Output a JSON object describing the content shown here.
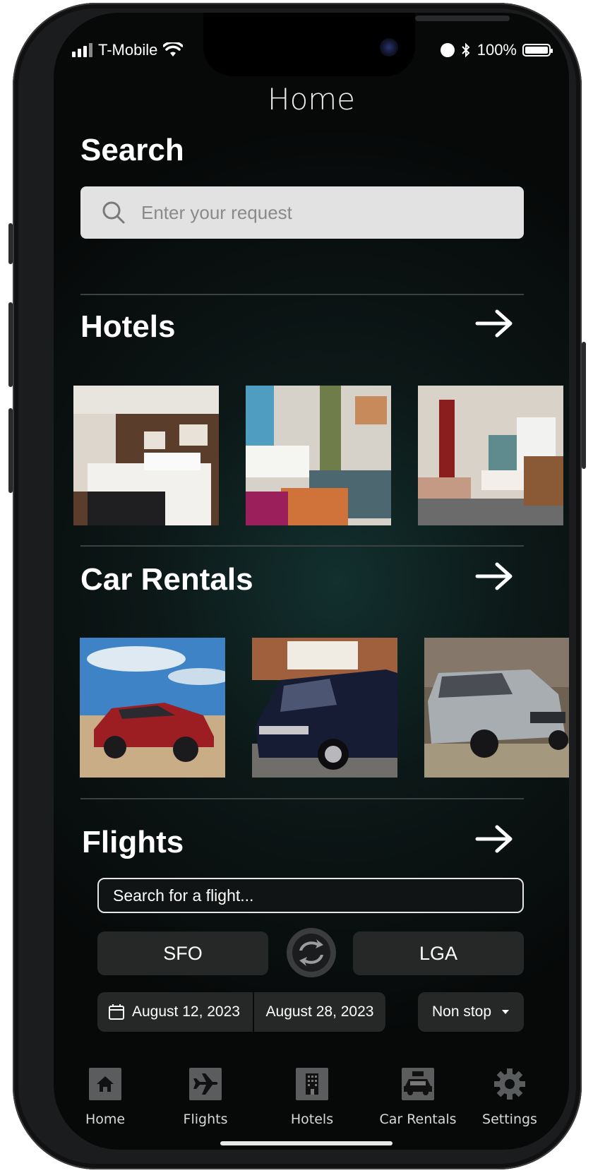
{
  "status": {
    "carrier": "T-Mobile",
    "battery": "100%"
  },
  "page": {
    "title": "Home"
  },
  "search": {
    "heading": "Search",
    "placeholder": "Enter your request"
  },
  "sections": {
    "hotels": {
      "title": "Hotels"
    },
    "car_rentals": {
      "title": "Car Rentals"
    },
    "flights": {
      "title": "Flights",
      "search_placeholder": "Search for a flight...",
      "from": "SFO",
      "to": "LGA",
      "depart_date": "August 12, 2023",
      "return_date": "August 28, 2023",
      "stops": "Non stop"
    }
  },
  "tabbar": {
    "items": [
      {
        "label": "Home",
        "icon": "home-icon"
      },
      {
        "label": "Flights",
        "icon": "airplane-icon"
      },
      {
        "label": "Hotels",
        "icon": "building-icon"
      },
      {
        "label": "Car Rentals",
        "icon": "car-rental-icon"
      },
      {
        "label": "Settings",
        "icon": "gear-icon"
      }
    ]
  },
  "colors": {
    "background": "#0b1514",
    "accent_teal": "#12302e",
    "search_box": "#e2e2e2",
    "pill": "#262828"
  }
}
